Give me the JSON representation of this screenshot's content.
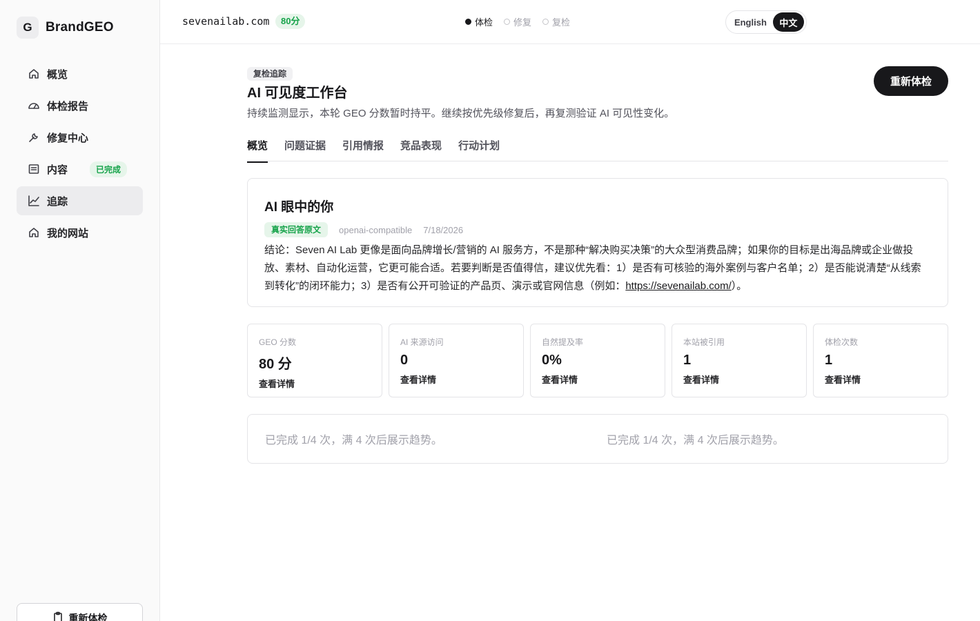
{
  "brand": {
    "mark": "G",
    "name": "BrandGEO"
  },
  "sidebar": {
    "items": [
      {
        "label": "概览",
        "icon": "home-icon"
      },
      {
        "label": "体检报告",
        "icon": "gauge-icon"
      },
      {
        "label": "修复中心",
        "icon": "wrench-icon"
      },
      {
        "label": "内容",
        "icon": "document-icon",
        "badge": "已完成"
      },
      {
        "label": "追踪",
        "icon": "chart-line-icon",
        "active": true
      },
      {
        "label": "我的网站",
        "icon": "home-icon"
      }
    ],
    "bottom_button": "重新体检"
  },
  "topbar": {
    "domain": "sevenailab.com",
    "score": "80分",
    "steps": [
      "体检",
      "修复",
      "复检"
    ],
    "active_step": "体检",
    "lang": {
      "en": "English",
      "zh": "中文",
      "selected": "中文"
    }
  },
  "header": {
    "tag": "复检追踪",
    "title": "AI 可见度工作台",
    "description": "持续监测显示，本轮 GEO 分数暂时持平。继续按优先级修复后，再复测验证 AI 可见性变化。",
    "action": "重新体检"
  },
  "tabs": [
    "概览",
    "问题证据",
    "引用情报",
    "竞品表现",
    "行动计划"
  ],
  "active_tab": "概览",
  "ai_card": {
    "title": "AI 眼中的你",
    "tag": "真实回答原文",
    "source": "openai-compatible",
    "date": "7/18/2026",
    "answer_text": "结论：Seven AI Lab 更像是面向品牌增长/营销的 AI 服务方，不是那种“解决购买决策”的大众型消费品牌；如果你的目标是出海品牌或企业做投放、素材、自动化运营，它更可能合适。若要判断是否值得信，建议优先看：1）是否有可核验的海外案例与客户名单；2）是否能说清楚“从线索到转化”的闭环能力；3）是否有公开可验证的产品页、演示或官网信息（例如：",
    "answer_link": "https://sevenailab.com/",
    "answer_tail": "）。"
  },
  "stats": [
    {
      "label": "GEO 分数",
      "value": "80 分",
      "link": "查看详情"
    },
    {
      "label": "AI 来源访问",
      "value": "0",
      "link": "查看详情"
    },
    {
      "label": "自然提及率",
      "value": "0%",
      "link": "查看详情"
    },
    {
      "label": "本站被引用",
      "value": "1",
      "link": "查看详情"
    },
    {
      "label": "体检次数",
      "value": "1",
      "link": "查看详情"
    }
  ],
  "trend": {
    "left_message": "已完成 1/4 次，满 4 次后展示趋势。",
    "right_message": "已完成 1/4 次，满 4 次后展示趋势。"
  },
  "colors": {
    "accent": "#18181b",
    "success": "#16a34a",
    "success_bg": "#e6f5ea"
  }
}
